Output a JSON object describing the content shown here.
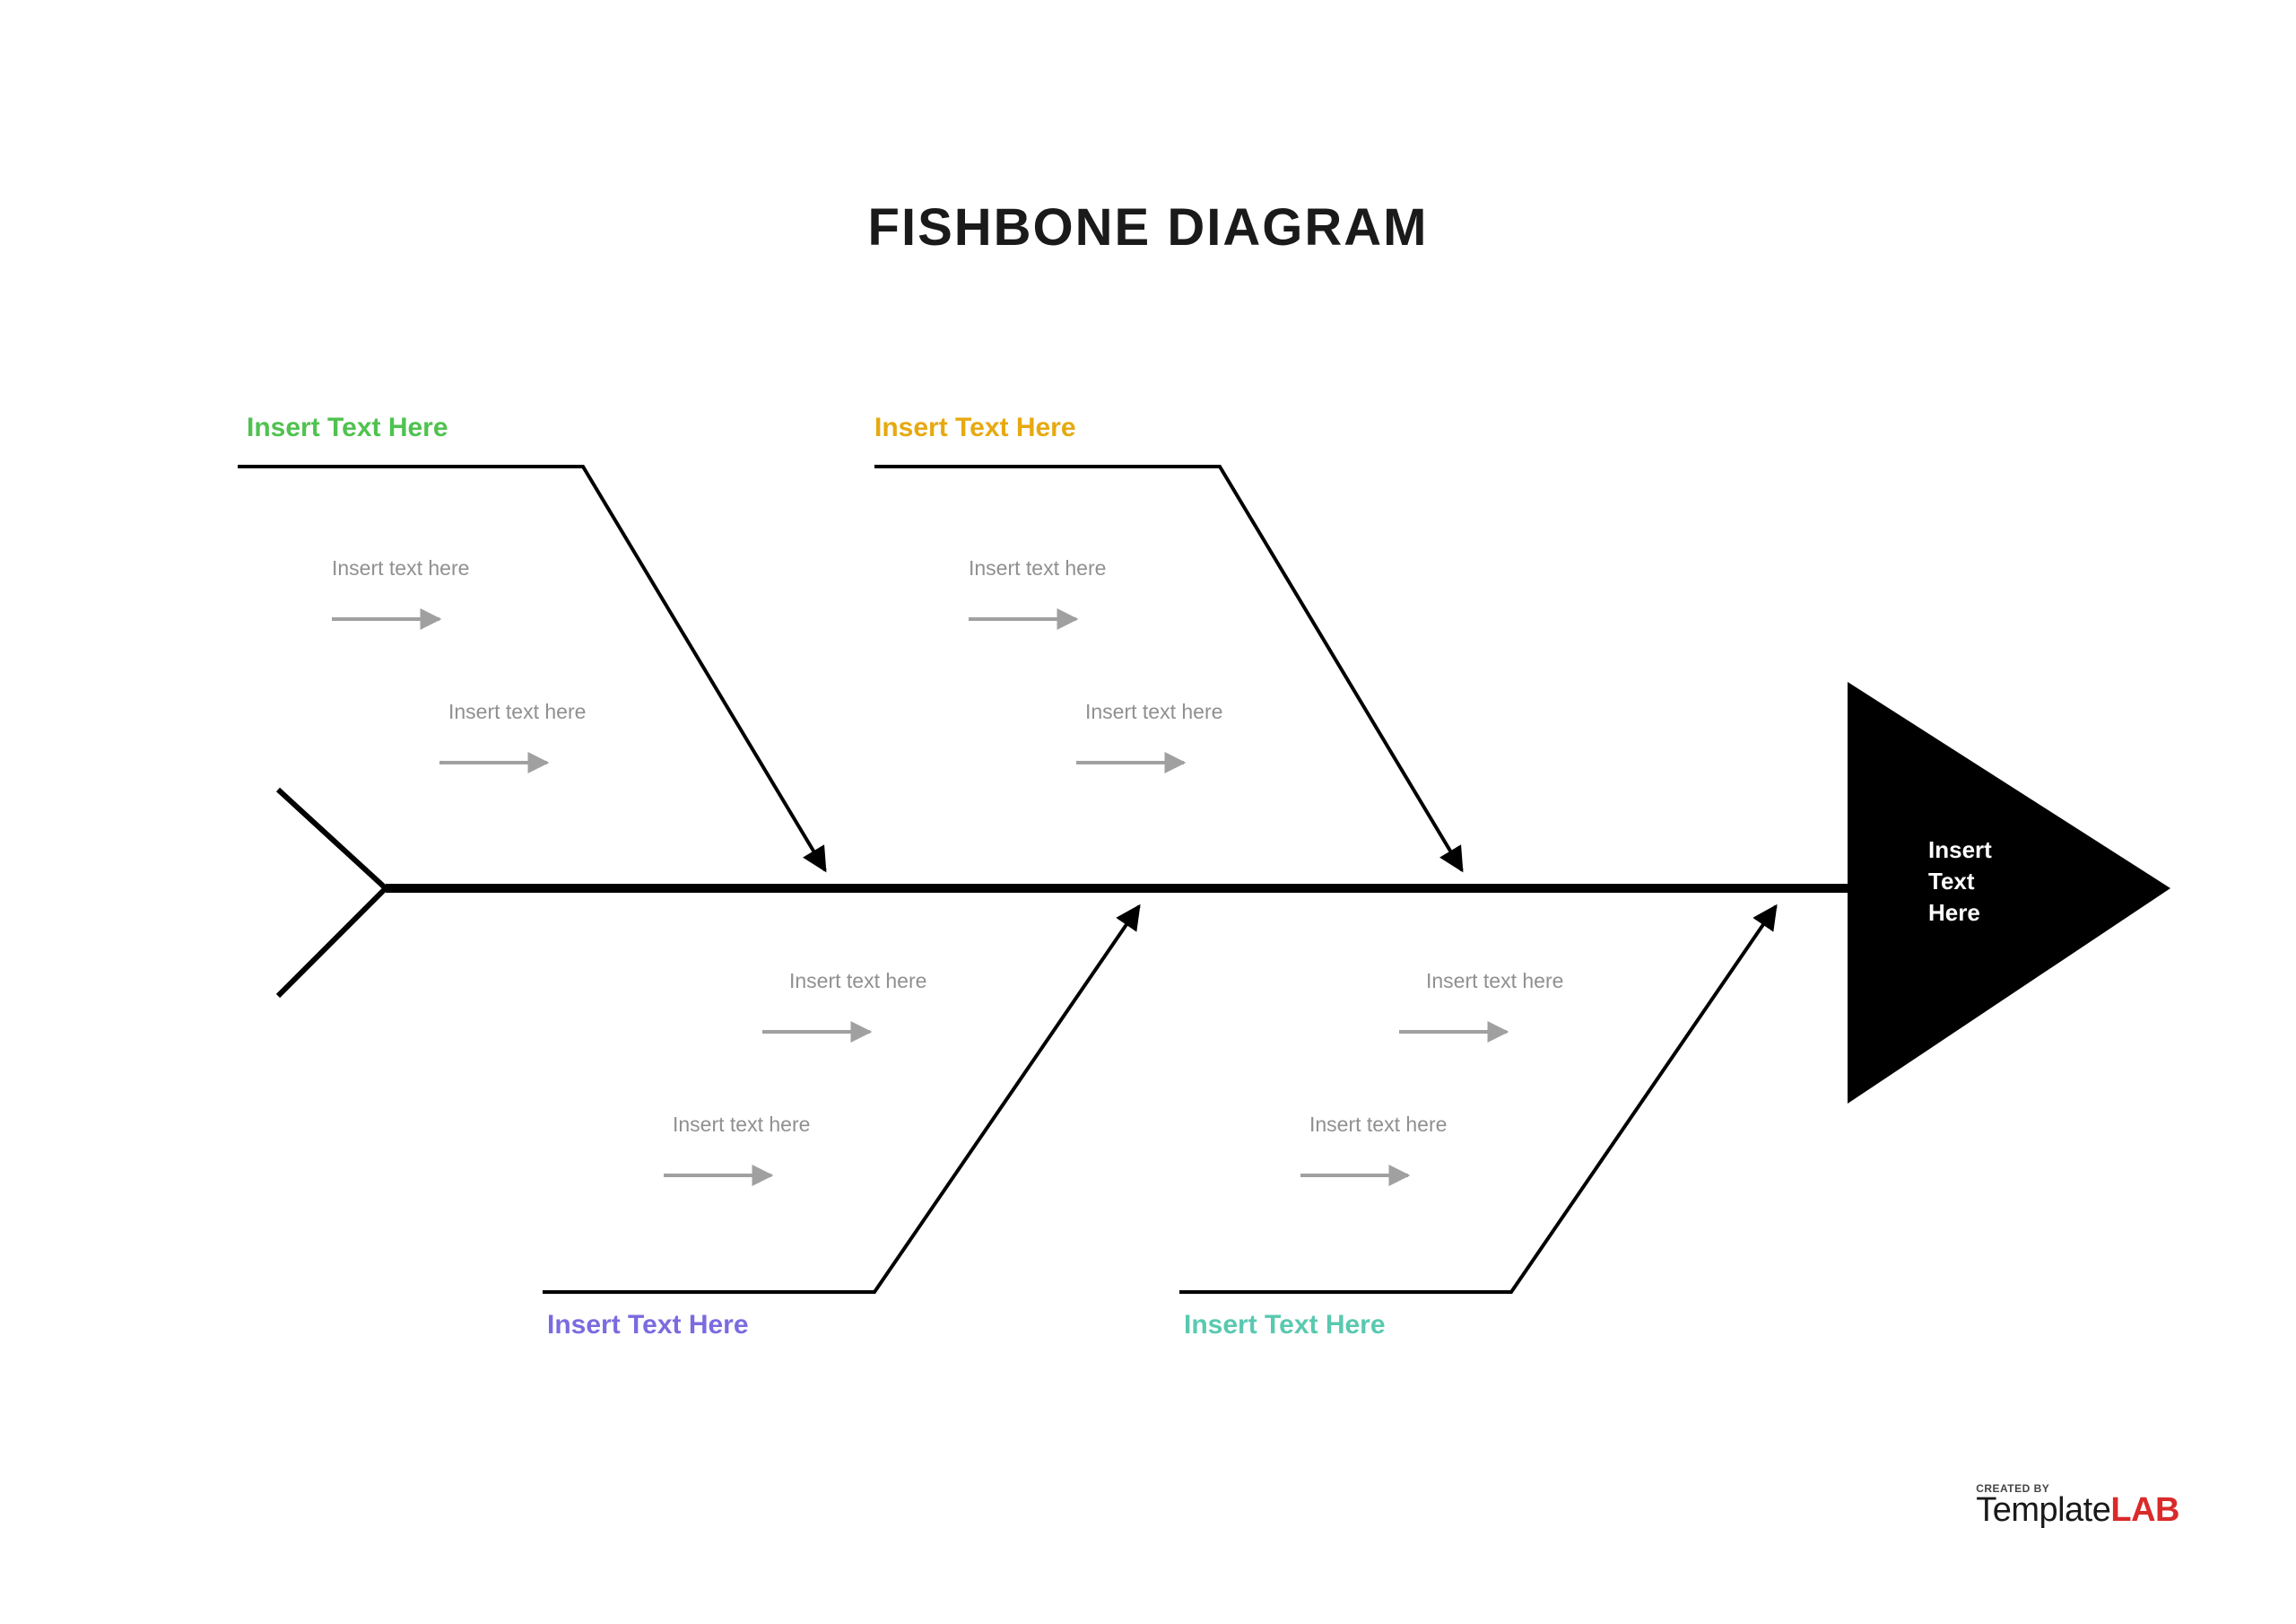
{
  "title": "FISHBONE DIAGRAM",
  "head": {
    "line1": "Insert",
    "line2": "Text",
    "line3": "Here"
  },
  "categories": {
    "top_left": {
      "label": "Insert Text Here",
      "color": "#4fc24f"
    },
    "top_right": {
      "label": "Insert Text Here",
      "color": "#e6a90f"
    },
    "bottom_left": {
      "label": "Insert Text Here",
      "color": "#7a6be0"
    },
    "bottom_right": {
      "label": "Insert Text Here",
      "color": "#59c9b0"
    }
  },
  "sub_placeholder": "Insert text here",
  "subs": {
    "top_left_1": "Insert text here",
    "top_left_2": "Insert text here",
    "top_right_1": "Insert text here",
    "top_right_2": "Insert text here",
    "bottom_left_1": "Insert text here",
    "bottom_left_2": "Insert text here",
    "bottom_right_1": "Insert text here",
    "bottom_right_2": "Insert text here"
  },
  "footer": {
    "created_by": "CREATED BY",
    "brand_main": "Template",
    "brand_accent": "LAB"
  }
}
